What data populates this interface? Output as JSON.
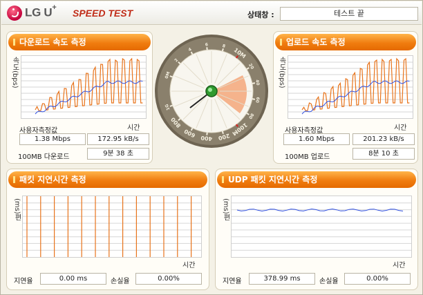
{
  "header": {
    "brand": "LG U",
    "brand_sup": "+",
    "title": "SPEED TEST",
    "status_label": "상태창 :",
    "status_value": "테스트 끝"
  },
  "download": {
    "title": "다운로드 속도 측정",
    "ylabel": "속도(bps)",
    "xlabel": "시간",
    "user_label": "사용자측정값",
    "mbps": "1.38 Mbps",
    "kbs": "172.95 kB/s",
    "file_label": "100MB 다운로드",
    "time": "9분 38 초"
  },
  "upload": {
    "title": "업로드 속도 측정",
    "ylabel": "속도(bps)",
    "xlabel": "시간",
    "user_label": "사용자측정값",
    "mbps": "1.60 Mbps",
    "kbs": "201.23 kB/s",
    "file_label": "100MB 업로드",
    "time": "8분 10 초"
  },
  "latency": {
    "title": "패킷 지연시간 측정",
    "ylabel": "(ms)편",
    "xlabel": "시간",
    "delay_label": "지연율",
    "delay_value": "0.00 ms",
    "loss_label": "손실율",
    "loss_value": "0.00%"
  },
  "udp": {
    "title": "UDP 패킷 지연시간 측정",
    "ylabel": "(ms)편",
    "xlabel": "시간",
    "delay_label": "지연율",
    "delay_value": "378.99 ms",
    "loss_label": "손실율",
    "loss_value": "0.00%"
  },
  "gauge": {
    "labels": [
      "0M",
      "2",
      "4",
      "6",
      "8",
      "10M",
      "20",
      "40",
      "60",
      "80",
      "100M",
      "200",
      "400",
      "600",
      "800",
      "1G"
    ],
    "needle_value": "1.6 Mbps"
  },
  "colors": {
    "accent_orange": "#e8731a",
    "series_blue": "#3050e0",
    "brand_red": "#c02c18"
  }
}
